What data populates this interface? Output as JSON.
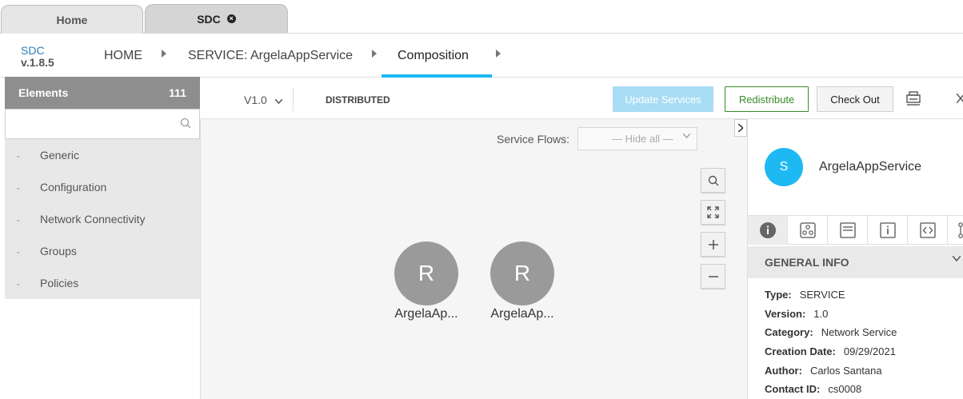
{
  "browser_tabs": [
    {
      "label": "Home"
    },
    {
      "label": "SDC",
      "close_glyph": "×"
    }
  ],
  "app": {
    "name": "SDC",
    "version": "v.1.8.5"
  },
  "breadcrumb": {
    "home": "HOME",
    "service": "SERVICE: ArgelaAppService",
    "composition": "Composition"
  },
  "palette": {
    "title": "Elements",
    "count": "111",
    "search_placeholder": "",
    "groups": [
      {
        "label": "Generic"
      },
      {
        "label": "Configuration"
      },
      {
        "label": "Network Connectivity"
      },
      {
        "label": "Groups"
      },
      {
        "label": "Policies"
      }
    ]
  },
  "toolbar": {
    "version": "V1.0",
    "status": "DISTRIBUTED",
    "update_label": "Update Services",
    "redistribute_label": "Redistribute",
    "checkout_label": "Check Out"
  },
  "canvas": {
    "service_flows_label": "Service Flows:",
    "service_flows_value": "— Hide all —",
    "nodes": [
      {
        "letter": "R",
        "label": "ArgelaAp..."
      },
      {
        "letter": "R",
        "label": "ArgelaAp..."
      }
    ]
  },
  "right_panel": {
    "avatar_letter": "S",
    "name": "ArgelaAppService",
    "section_title": "GENERAL INFO",
    "info": {
      "type_key": "Type:",
      "type_val": "SERVICE",
      "version_key": "Version:",
      "version_val": "1.0",
      "category_key": "Category:",
      "category_val": "Network Service",
      "creation_key": "Creation Date:",
      "creation_val": "09/29/2021",
      "author_key": "Author:",
      "author_val": "Carlos Santana",
      "contact_key": "Contact ID:",
      "contact_val": "cs0008"
    }
  },
  "colors": {
    "accent": "#1eb9f3",
    "redistribute": "#3a8a2a",
    "update_disabled": "#a8dcf5",
    "node": "#9a9a9a"
  }
}
